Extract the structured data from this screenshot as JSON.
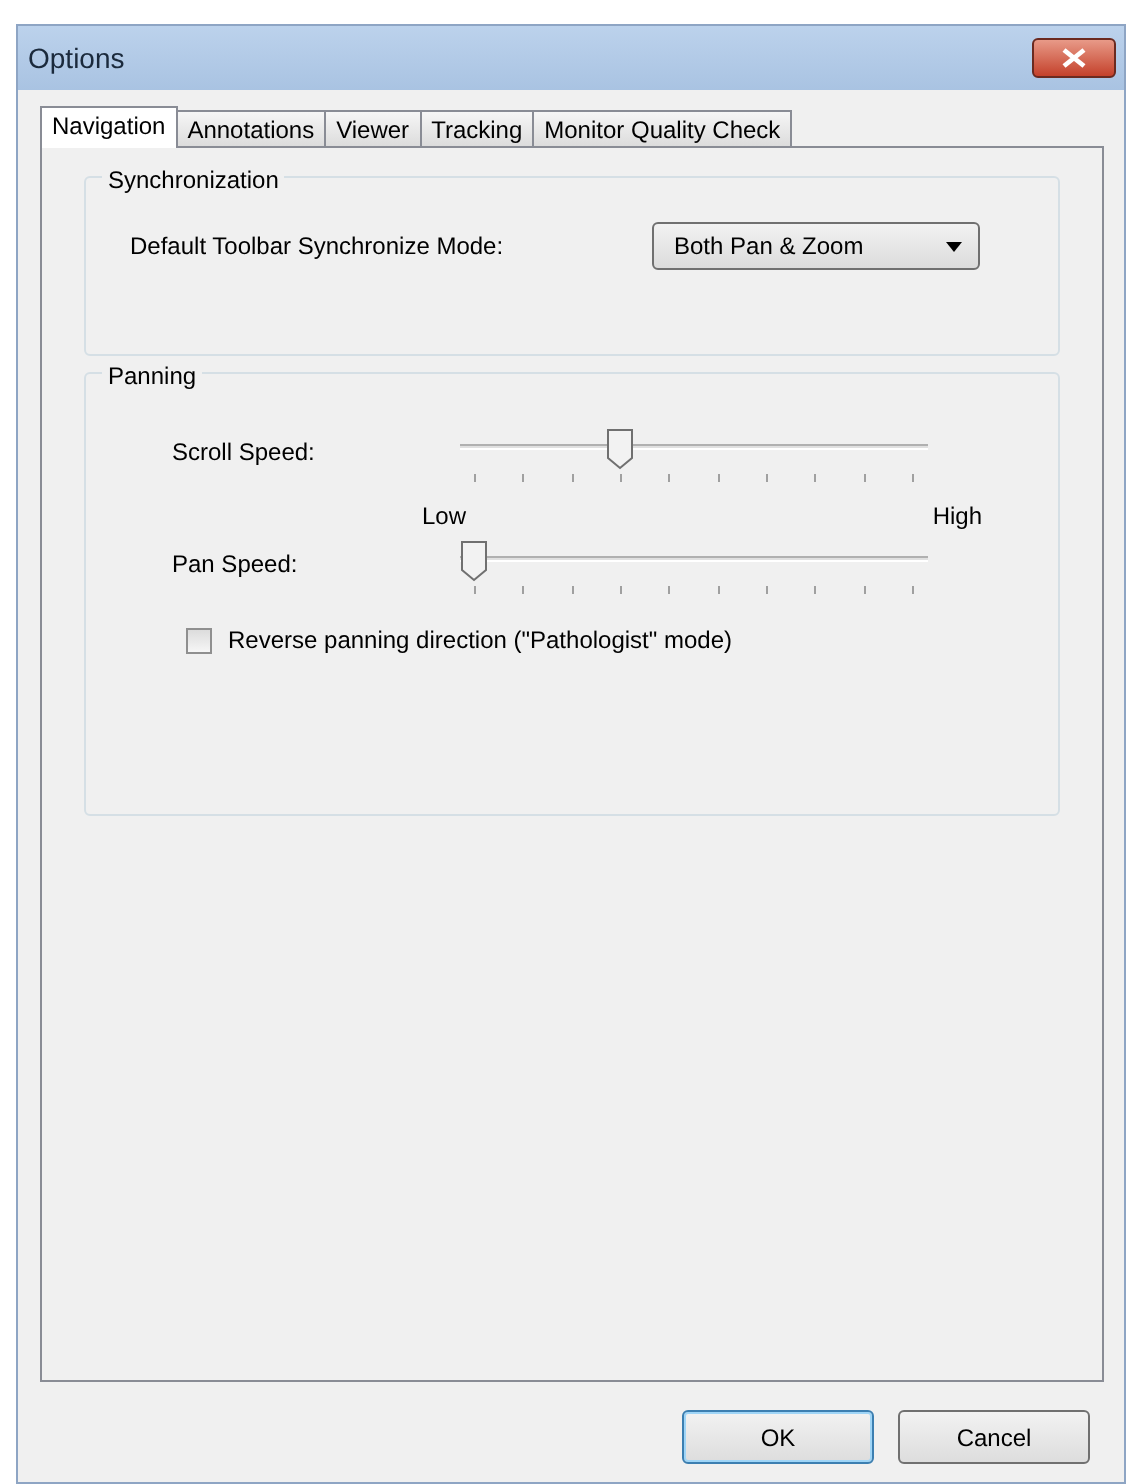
{
  "window": {
    "title": "Options"
  },
  "tabs": [
    {
      "label": "Navigation",
      "selected": true
    },
    {
      "label": "Annotations",
      "selected": false
    },
    {
      "label": "Viewer",
      "selected": false
    },
    {
      "label": "Tracking",
      "selected": false
    },
    {
      "label": "Monitor Quality Check",
      "selected": false
    }
  ],
  "synchronization": {
    "title": "Synchronization",
    "label": "Default Toolbar Synchronize Mode:",
    "value": "Both Pan & Zoom"
  },
  "panning": {
    "title": "Panning",
    "sliders": [
      {
        "label": "Scroll Speed:",
        "level": 0.333,
        "min_label": "Low",
        "max_label": "High"
      },
      {
        "label": "Pan Speed:",
        "level": 0
      }
    ],
    "checkbox": {
      "label": "Reverse panning direction (\"Pathologist\" mode)",
      "checked": false
    }
  },
  "buttons": [
    {
      "label": "OK",
      "default": true
    },
    {
      "label": "Cancel",
      "default": false
    }
  ]
}
